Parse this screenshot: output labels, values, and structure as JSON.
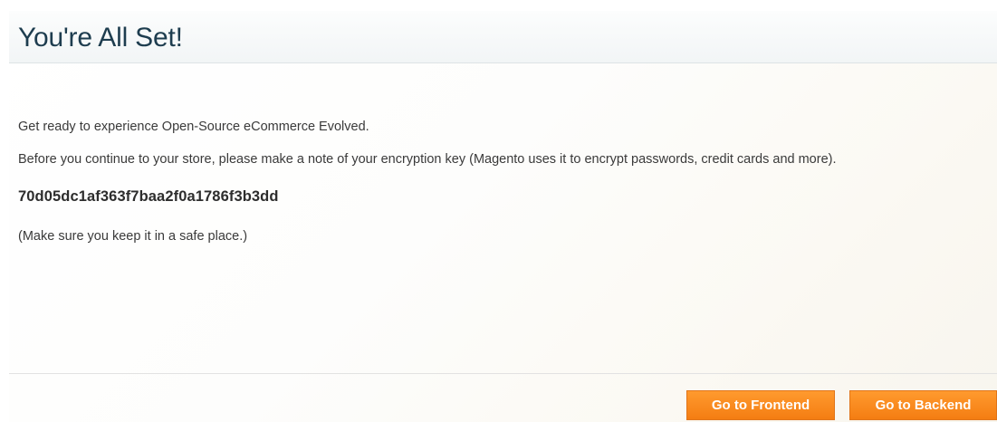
{
  "header": {
    "title": "You're All Set!"
  },
  "content": {
    "intro": "Get ready to experience Open-Source eCommerce Evolved.",
    "note": "Before you continue to your store, please make a note of your encryption key (Magento uses it to encrypt passwords, credit cards and more).",
    "encryption_key": "70d05dc1af363f7baa2f0a1786f3b3dd",
    "safe_note": "(Make sure you keep it in a safe place.)"
  },
  "actions": {
    "frontend_label": "Go to Frontend",
    "backend_label": "Go to Backend"
  },
  "colors": {
    "button_accent": "#f47d12",
    "title_text": "#1e3d4f"
  }
}
